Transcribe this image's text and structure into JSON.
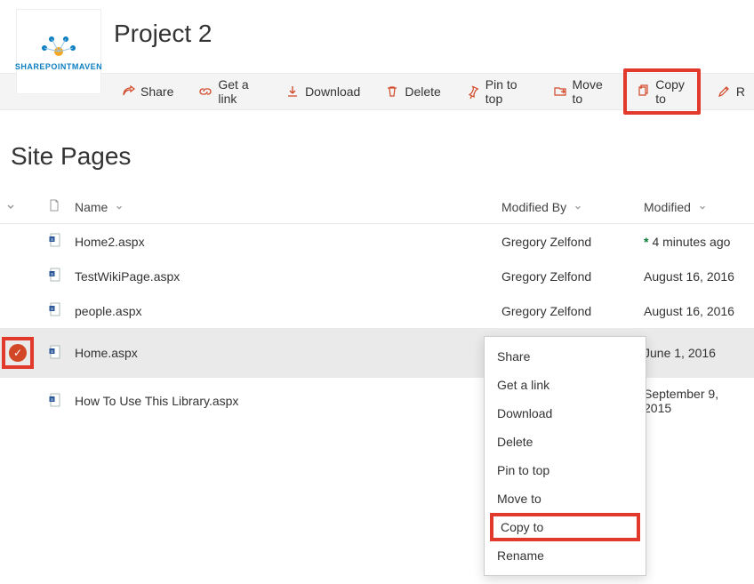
{
  "site_title": "Project 2",
  "logo_text": "SHAREPOINTMAVEN",
  "library_title": "Site Pages",
  "toolbar": {
    "share": "Share",
    "get_a_link": "Get a link",
    "download": "Download",
    "delete": "Delete",
    "pin_to_top": "Pin to top",
    "move_to": "Move to",
    "copy_to": "Copy to",
    "rename_hint": "R"
  },
  "columns": {
    "name": "Name",
    "modified_by": "Modified By",
    "modified": "Modified"
  },
  "rows": [
    {
      "name": "Home2.aspx",
      "modified_by": "Gregory Zelfond",
      "modified": "4 minutes ago",
      "is_new": true,
      "selected": false
    },
    {
      "name": "TestWikiPage.aspx",
      "modified_by": "Gregory Zelfond",
      "modified": "August 16, 2016",
      "is_new": false,
      "selected": false
    },
    {
      "name": "people.aspx",
      "modified_by": "Gregory Zelfond",
      "modified": "August 16, 2016",
      "is_new": false,
      "selected": false
    },
    {
      "name": "Home.aspx",
      "modified_by": "",
      "modified": "June 1, 2016",
      "is_new": false,
      "selected": true
    },
    {
      "name": "How To Use This Library.aspx",
      "modified_by": "",
      "modified": "September 9, 2015",
      "is_new": false,
      "selected": false
    }
  ],
  "context_menu": {
    "items": [
      "Share",
      "Get a link",
      "Download",
      "Delete",
      "Pin to top",
      "Move to",
      "Copy to",
      "Rename"
    ],
    "highlighted_index": 6
  },
  "colors": {
    "accent": "#d24726",
    "highlight_border": "#e13a2d",
    "new_green": "#0a7c36"
  }
}
